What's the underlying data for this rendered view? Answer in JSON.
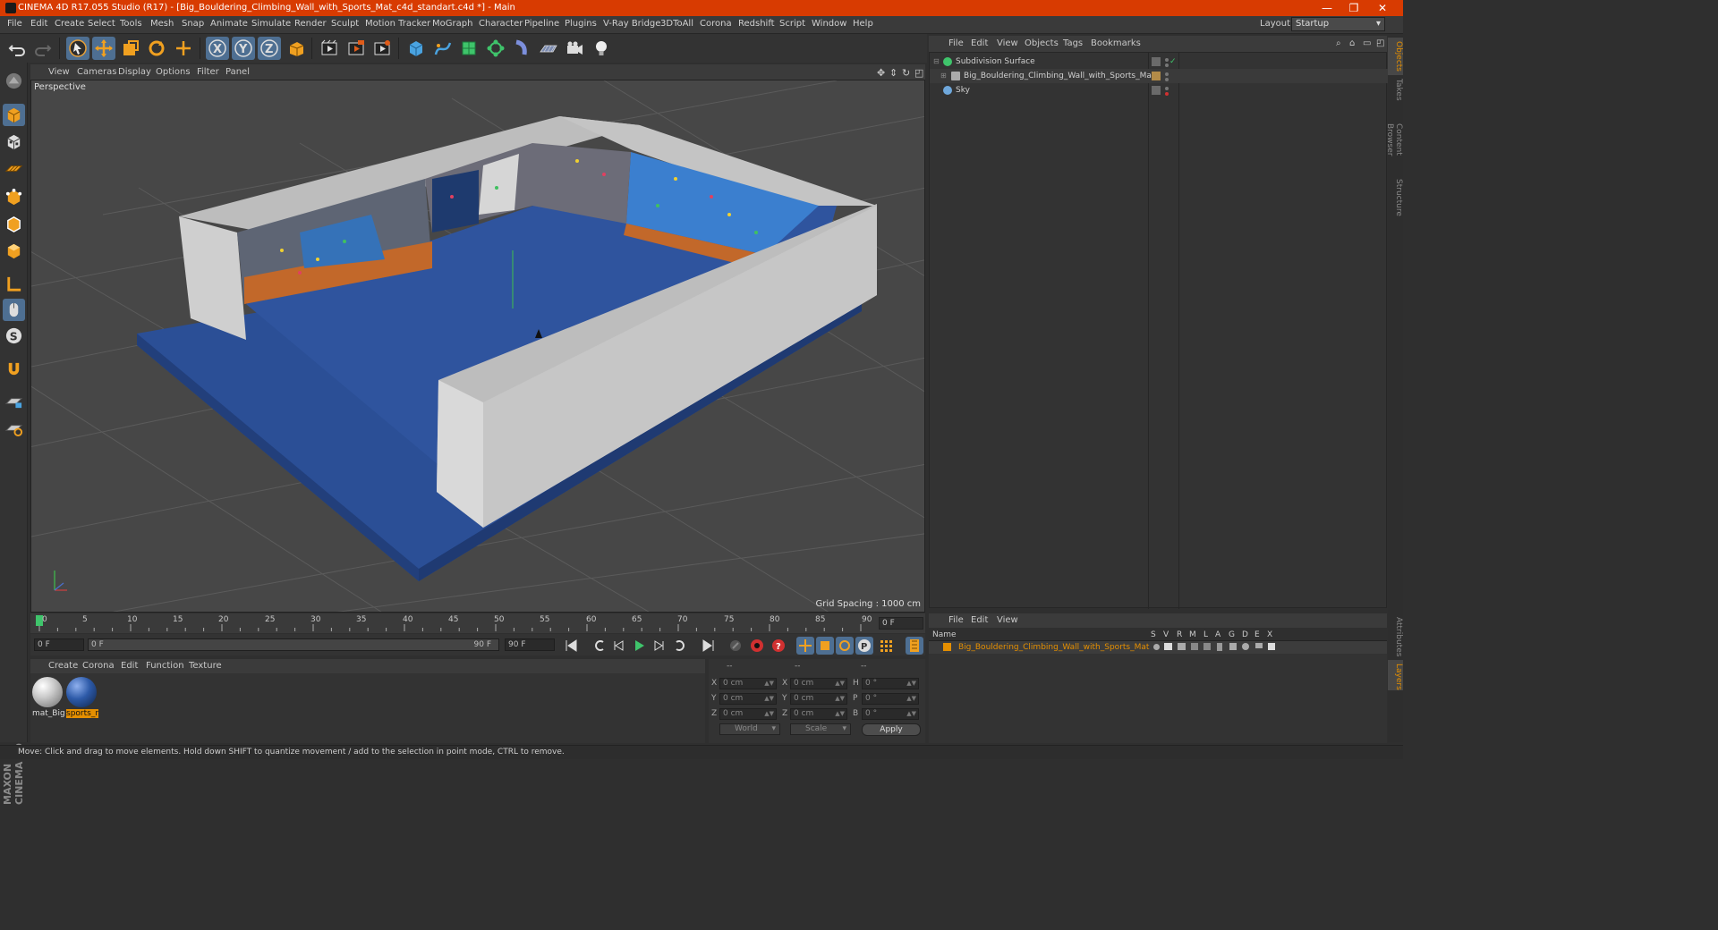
{
  "window": {
    "title": "CINEMA 4D R17.055 Studio (R17) - [Big_Bouldering_Climbing_Wall_with_Sports_Mat_c4d_standart.c4d *] - Main",
    "controls": [
      "—",
      "❐",
      "✕"
    ]
  },
  "menubar": {
    "items": [
      "File",
      "Edit",
      "Create",
      "Select",
      "Tools",
      "Mesh",
      "Snap",
      "Animate",
      "Simulate",
      "Render",
      "Sculpt",
      "Motion Tracker",
      "MoGraph",
      "Character",
      "Pipeline",
      "Plugins",
      "V-Ray Bridge",
      "3DToAll",
      "Corona",
      "Redshift",
      "Script",
      "Window",
      "Help"
    ],
    "layout_label": "Layout:",
    "layout_value": "Startup"
  },
  "toolbar": {
    "icons": [
      "undo-icon",
      "redo-icon",
      "select-cursor-icon",
      "move-icon",
      "scale-icon",
      "rotate-icon",
      "live-select-icon",
      "x-axis-icon",
      "y-axis-icon",
      "z-axis-icon",
      "coordinate-system-icon",
      "render-view-icon",
      "render-picture-viewer-icon",
      "edit-render-settings-icon",
      "cube-primitive-icon",
      "spline-pen-icon",
      "subdivision-nurbs-icon",
      "array-icon",
      "deformer-icon",
      "floor-icon",
      "camera-icon",
      "light-icon"
    ]
  },
  "viewport": {
    "menu": [
      "View",
      "Cameras",
      "Display",
      "Options",
      "Filter",
      "Panel"
    ],
    "label": "Perspective",
    "grid_spacing": "Grid Spacing : 1000 cm"
  },
  "timeline": {
    "ticks": [
      "0",
      "5",
      "10",
      "15",
      "20",
      "25",
      "30",
      "35",
      "40",
      "45",
      "50",
      "55",
      "60",
      "65",
      "70",
      "75",
      "80",
      "85",
      "90"
    ],
    "current_frame": "0 F"
  },
  "transport": {
    "start_frame": "0 F",
    "range_start": "0 F",
    "range_end": "90 F",
    "end_frame": "90 F"
  },
  "material_manager": {
    "menu": [
      "Create",
      "Corona",
      "Edit",
      "Function",
      "Texture"
    ],
    "materials": [
      {
        "name": "mat_Big",
        "color": "#c9c9c9",
        "selected": false
      },
      {
        "name": "sports_r",
        "color": "#2d5aa8",
        "selected": true
      }
    ]
  },
  "coordinates": {
    "header": [
      "--",
      "--",
      "--"
    ],
    "rows": [
      {
        "axis": "X",
        "pos": "0 cm",
        "size_axis": "X",
        "size": "0 cm",
        "rot_axis": "H",
        "rot": "0 °"
      },
      {
        "axis": "Y",
        "pos": "0 cm",
        "size_axis": "Y",
        "size": "0 cm",
        "rot_axis": "P",
        "rot": "0 °"
      },
      {
        "axis": "Z",
        "pos": "0 cm",
        "size_axis": "Z",
        "size": "0 cm",
        "rot_axis": "B",
        "rot": "0 °"
      }
    ],
    "mode1": "World",
    "mode2": "Scale",
    "apply": "Apply"
  },
  "status": "Move: Click and drag to move elements. Hold down SHIFT to quantize movement / add to the selection in point mode, CTRL to remove.",
  "object_manager": {
    "menu": [
      "File",
      "Edit",
      "View",
      "Objects",
      "Tags",
      "Bookmarks"
    ],
    "objects": [
      {
        "name": "Subdivision Surface",
        "icon_color": "#3fc46b"
      },
      {
        "name": "Big_Bouldering_Climbing_Wall_with_Sports_Mat",
        "icon_color": "#aaaaaa"
      },
      {
        "name": "Sky",
        "icon_color": "#6fa8dc"
      }
    ]
  },
  "right_tabs": [
    "Objects",
    "Takes",
    "Content Browser",
    "Structure"
  ],
  "right_tabs_bottom": [
    "Attributes",
    "Layers"
  ],
  "layer_manager": {
    "menu": [
      "File",
      "Edit",
      "View"
    ],
    "columns": [
      "Name",
      "S",
      "V",
      "R",
      "M",
      "L",
      "A",
      "G",
      "D",
      "E",
      "X"
    ],
    "layer_name": "Big_Bouldering_Climbing_Wall_with_Sports_Mat",
    "layer_color": "#e58f00"
  },
  "branding": "MAXON CINEMA 4D"
}
